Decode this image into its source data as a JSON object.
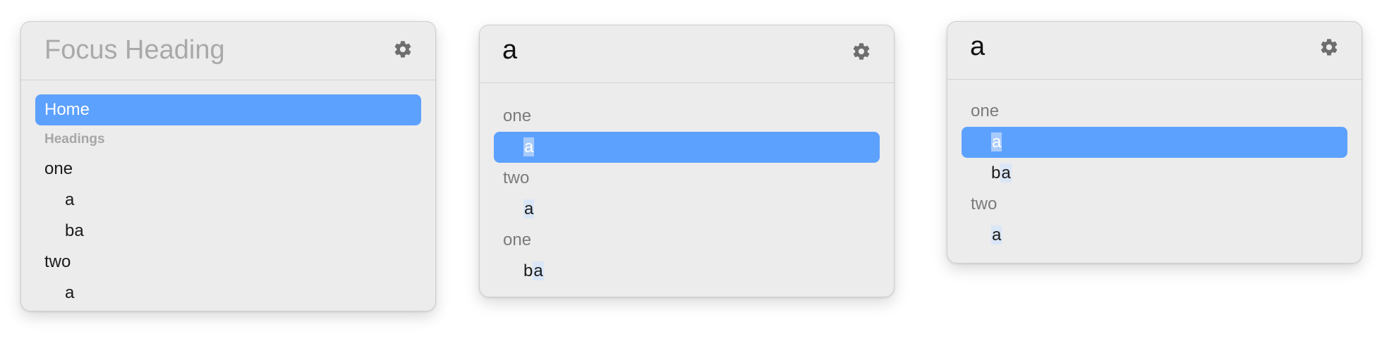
{
  "panels": [
    {
      "title": "Focus Heading",
      "title_is_placeholder": true,
      "settings_icon": "gear-icon",
      "home_label": "Home",
      "section_label": "Headings",
      "items": [
        {
          "label": "one"
        },
        {
          "label": "a"
        },
        {
          "label": "ba"
        },
        {
          "label": "two"
        },
        {
          "label": "a"
        }
      ]
    },
    {
      "title": "a",
      "settings_icon": "gear-icon",
      "items": [
        {
          "label": "one"
        },
        {
          "label": "a",
          "match": "a",
          "rest": ""
        },
        {
          "label": "two"
        },
        {
          "label": "a",
          "match": "a",
          "rest": ""
        },
        {
          "label": "one"
        },
        {
          "label": "ba",
          "prefix": "b",
          "match": "a"
        }
      ]
    },
    {
      "title": "a",
      "settings_icon": "gear-icon",
      "items": [
        {
          "label": "one"
        },
        {
          "label": "a",
          "match": "a"
        },
        {
          "label": "ba",
          "prefix": "b",
          "match": "a"
        },
        {
          "label": "two"
        },
        {
          "label": "a",
          "match": "a"
        }
      ]
    }
  ],
  "colors": {
    "selection": "#5da1ff",
    "match_highlight": "#d9e6f7",
    "panel_bg": "#ececec"
  }
}
